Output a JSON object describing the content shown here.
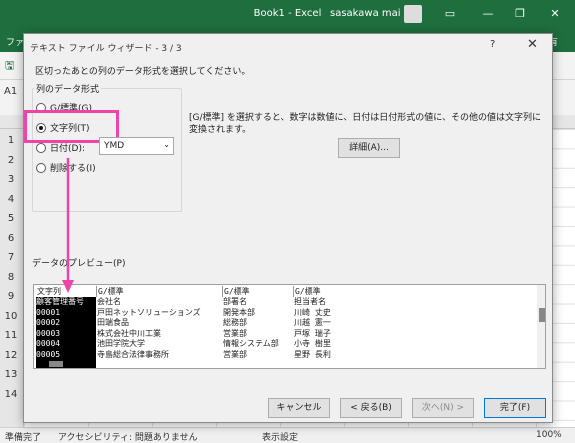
{
  "excel": {
    "title": "Book1  -  Excel",
    "user": "sasakawa mai",
    "name_box": "A1",
    "column_i": "I",
    "ribbon_first": "ファイ",
    "ribbon_share": "ム 共有",
    "row_numbers": [
      "1",
      "2",
      "3",
      "4",
      "5",
      "6",
      "7",
      "8",
      "9",
      "10",
      "11",
      "12",
      "13",
      "14"
    ],
    "status": {
      "ready": "準備完了",
      "accessibility": "アクセシビリティ: 問題ありません",
      "display_settings": "表示設定",
      "zoom": "100%"
    }
  },
  "dialog": {
    "title": "テキスト ファイル ウィザード - 3 / 3",
    "help": "?",
    "close": "✕",
    "instruction": "区切ったあとの列のデータ形式を選択してください。",
    "group_label": "列のデータ形式",
    "radios": [
      {
        "label": "G/標準(G)",
        "selected": false
      },
      {
        "label": "文字列(T)",
        "selected": true
      },
      {
        "label": "日付(D):",
        "selected": false
      },
      {
        "label": "削除する(I)",
        "selected": false
      }
    ],
    "date_format": "YMD",
    "description": "[G/標準] を選択すると、数字は数値に、日付は日付形式の値に、その他の値は文字列に変換されます。",
    "detail_button": "詳細(A)...",
    "preview_label": "データのプレビュー(P)",
    "preview": {
      "headers": [
        "文字列",
        "G/標準",
        "G/標準",
        "G/標準"
      ],
      "columns": [
        [
          "顧客管理番号",
          "00001",
          "00002",
          "00003",
          "00004",
          "00005"
        ],
        [
          "会社名",
          "戸田ネットソリューションズ",
          "田端食品",
          "株式会社中川工業",
          "池田学院大学",
          "寺島総合法律事務所"
        ],
        [
          "部署名",
          "開発本部",
          "総務部",
          "営業部",
          "情報システム部",
          "営業部"
        ],
        [
          "担当者名",
          "川崎 丈史",
          "川越 憲一",
          "戸塚 瑞子",
          "小寺 樹里",
          "星野 長利"
        ]
      ]
    },
    "buttons": {
      "cancel": "キャンセル",
      "back": "< 戻る(B)",
      "next": "次へ(N) >",
      "finish": "完了(F)"
    }
  },
  "colors": {
    "excel_green": "#1e6e3e",
    "highlight": "#ee44aa"
  }
}
